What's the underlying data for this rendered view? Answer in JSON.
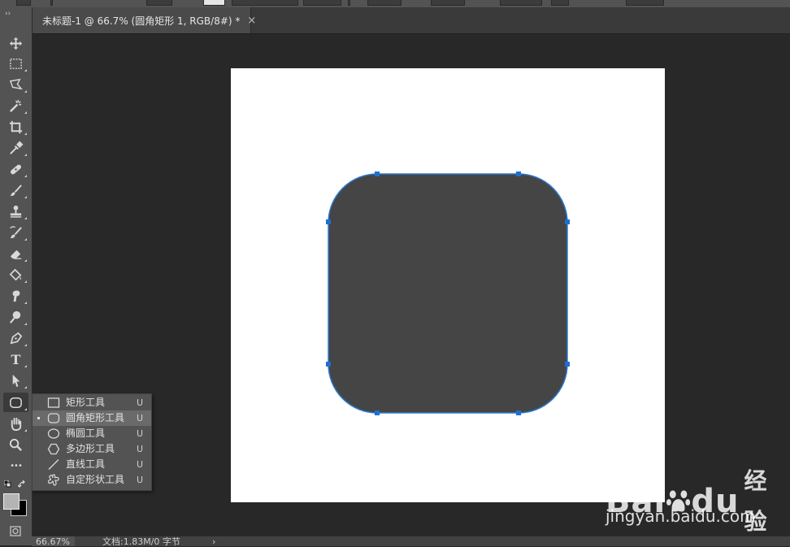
{
  "document_tab": {
    "title": "未标题-1 @ 66.7% (圆角矩形 1, RGB/8#) *",
    "close_glyph": "×"
  },
  "toolbar": {
    "collapse_glyph": "››",
    "tools": [
      {
        "name": "move-tool",
        "icon": "move-icon"
      },
      {
        "name": "marquee-tool",
        "icon": "rect-marquee-icon"
      },
      {
        "name": "lasso-tool",
        "icon": "polygonal-lasso-icon"
      },
      {
        "name": "magic-wand-tool",
        "icon": "magic-wand-icon"
      },
      {
        "name": "crop-tool",
        "icon": "crop-icon"
      },
      {
        "name": "eyedropper-tool",
        "icon": "eyedropper-icon"
      },
      {
        "name": "healing-brush-tool",
        "icon": "bandage-icon"
      },
      {
        "name": "brush-tool",
        "icon": "brush-icon"
      },
      {
        "name": "clone-stamp-tool",
        "icon": "stamp-icon"
      },
      {
        "name": "history-brush-tool",
        "icon": "history-brush-icon"
      },
      {
        "name": "eraser-tool",
        "icon": "eraser-icon"
      },
      {
        "name": "paint-bucket-tool",
        "icon": "paint-bucket-icon"
      },
      {
        "name": "smudge-tool",
        "icon": "smudge-icon"
      },
      {
        "name": "dodge-tool",
        "icon": "dodge-icon"
      },
      {
        "name": "pen-tool",
        "icon": "pen-icon"
      },
      {
        "name": "type-tool",
        "icon": "type-icon",
        "glyph": "T"
      },
      {
        "name": "path-selection-tool",
        "icon": "arrow-icon"
      },
      {
        "name": "rounded-rectangle-tool",
        "icon": "rounded-rect-icon",
        "active": true
      },
      {
        "name": "hand-tool",
        "icon": "hand-icon"
      },
      {
        "name": "zoom-tool",
        "icon": "magnifier-icon"
      },
      {
        "name": "more-tools",
        "icon": "ellipsis-icon",
        "glyph": "•••"
      }
    ]
  },
  "flyout": {
    "items": [
      {
        "label": "矩形工具",
        "key": "U",
        "icon": "rectangle-icon",
        "selected": false
      },
      {
        "label": "圆角矩形工具",
        "key": "U",
        "icon": "rounded-rectangle-icon",
        "selected": true
      },
      {
        "label": "椭圆工具",
        "key": "U",
        "icon": "ellipse-icon",
        "selected": false
      },
      {
        "label": "多边形工具",
        "key": "U",
        "icon": "polygon-icon",
        "selected": false
      },
      {
        "label": "直线工具",
        "key": "U",
        "icon": "line-icon",
        "selected": false
      },
      {
        "label": "自定形状工具",
        "key": "U",
        "icon": "custom-shape-icon",
        "selected": false
      }
    ]
  },
  "colors": {
    "shape_fill": "#454545",
    "path_stroke": "#2a7bd4",
    "anchor": "#1e6fd0",
    "canvas": "#ffffff",
    "pasteboard": "#282828",
    "foreground": "#b4b4b4",
    "background": "#000000"
  },
  "statusbar": {
    "zoom": "66.67%",
    "doc_info": "文档:1.83M/0 字节",
    "arrow": "›"
  },
  "watermark": {
    "logo_text": "Bai",
    "logo_text2": "du",
    "cn_text": "经验",
    "url": "jingyan.baidu.com"
  }
}
